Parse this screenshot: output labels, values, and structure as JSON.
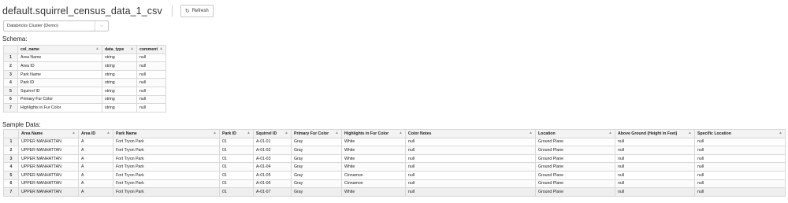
{
  "header": {
    "title": "default.squirrel_census_data_1_csv",
    "refresh_label": "Refresh",
    "refresh_icon": "refresh-icon"
  },
  "cluster": {
    "selected": "Databricks Cluster (Demo)",
    "icon": "chevron-down-icon"
  },
  "schema": {
    "label": "Schema:",
    "columns": [
      "col_name",
      "data_type",
      "comment"
    ],
    "rows": [
      [
        "Area Name",
        "string",
        "null"
      ],
      [
        "Area ID",
        "string",
        "null"
      ],
      [
        "Park Name",
        "string",
        "null"
      ],
      [
        "Park ID",
        "string",
        "null"
      ],
      [
        "Squirrel ID",
        "string",
        "null"
      ],
      [
        "Primary Fur Color",
        "string",
        "null"
      ],
      [
        "Highlights in Fur Color",
        "string",
        "null"
      ]
    ]
  },
  "sample": {
    "label": "Sample Data:",
    "columns": [
      "Area Name",
      "Area ID",
      "Park Name",
      "Park ID",
      "Squirrel ID",
      "Primary Fur Color",
      "Highlights in Fur Color",
      "Color Notes",
      "Location",
      "Above Ground (Height in Feet)",
      "Specific Location"
    ],
    "rows": [
      [
        "UPPER MANHATTAN",
        "A",
        "Fort Tryon Park",
        "01",
        "A-01-01",
        "Gray",
        "White",
        "null",
        "Ground Plane",
        "null",
        "null"
      ],
      [
        "UPPER MANHATTAN",
        "A",
        "Fort Tryon Park",
        "01",
        "A-01-02",
        "Gray",
        "White",
        "null",
        "Ground Plane",
        "null",
        "null"
      ],
      [
        "UPPER MANHATTAN",
        "A",
        "Fort Tryon Park",
        "01",
        "A-01-03",
        "Gray",
        "White",
        "null",
        "Ground Plane",
        "null",
        "null"
      ],
      [
        "UPPER MANHATTAN",
        "A",
        "Fort Tryon Park",
        "01",
        "A-01-04",
        "Gray",
        "White",
        "null",
        "Ground Plane",
        "null",
        "null"
      ],
      [
        "UPPER MANHATTAN",
        "A",
        "Fort Tryon Park",
        "01",
        "A-01-05",
        "Gray",
        "Cinnamon",
        "null",
        "Ground Plane",
        "null",
        "null"
      ],
      [
        "UPPER MANHATTAN",
        "A",
        "Fort Tryon Park",
        "01",
        "A-01-06",
        "Gray",
        "Cinnamon",
        "null",
        "Ground Plane",
        "null",
        "null"
      ],
      [
        "UPPER MANHATTAN",
        "A",
        "Fort Tryon Park",
        "01",
        "A-01-07",
        "Gray",
        "White",
        "null",
        "Ground Plane",
        "null",
        "null"
      ]
    ]
  },
  "colors": {
    "header_bg": "#f3f3f3",
    "border": "#d9d9d9"
  }
}
